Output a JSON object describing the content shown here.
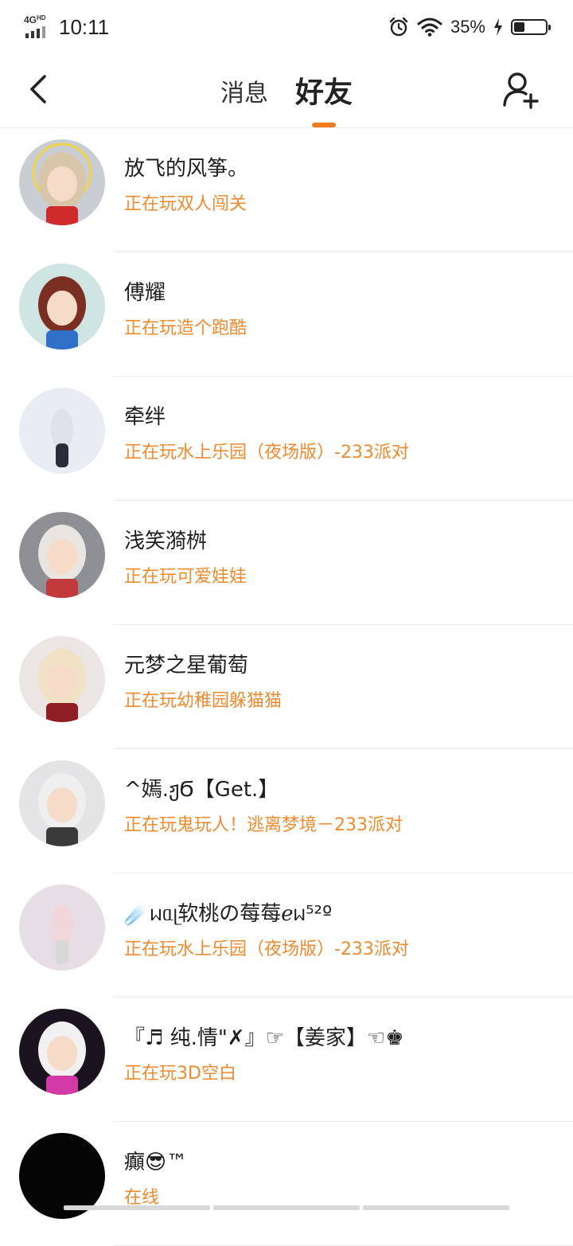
{
  "status_bar": {
    "network": "4G",
    "network_sub": "HD",
    "time": "10:11",
    "battery": "35%",
    "battery_level": 0.35
  },
  "nav": {
    "tab_messages": "消息",
    "tab_friends": "好友",
    "active_tab": "好友",
    "accent": "#f07c22"
  },
  "colors": {
    "status_text": "#f08a2e",
    "name_text": "#1e1e1e"
  },
  "friends": [
    {
      "name": "放飞的风筝。",
      "status": "正在玩双人闯关",
      "avatar_bg": "#c9cdd4",
      "hair": "#d8c6a8",
      "accent": "#d12a2a",
      "glow": "#f3d34a"
    },
    {
      "name": "傅耀",
      "status": "正在玩造个跑酷",
      "avatar_bg": "#cfe5e3",
      "hair": "#7a2f22",
      "accent": "#3070c8",
      "glow": ""
    },
    {
      "name": "牵绊",
      "status": "正在玩水上乐园（夜场版）-233派对",
      "avatar_bg": "#e8ecf4",
      "hair": "#dfe2ea",
      "accent": "#2a2e3a",
      "glow": ""
    },
    {
      "name": "浅笑漪桝",
      "status": "正在玩可爱娃娃",
      "avatar_bg": "#8e9096",
      "hair": "#e9e6e2",
      "accent": "#c23a3a",
      "glow": ""
    },
    {
      "name": "元梦之星葡萄",
      "status": "正在玩幼稚园躲猫猫",
      "avatar_bg": "#ebe5e4",
      "hair": "#f1e2c6",
      "accent": "#8f1e24",
      "glow": ""
    },
    {
      "name": "^嫣.ჟϬ【Get.】",
      "status": "正在玩鬼玩人！逃离梦境－233派对",
      "avatar_bg": "#e4e4e6",
      "hair": "#efefef",
      "accent": "#3a3a3a",
      "glow": ""
    },
    {
      "name": "☄️ᥕᥲᥨ软桃の莓莓ℯᥕ⁵²º",
      "status": "正在玩水上乐园（夜场版）-233派对",
      "avatar_bg": "#e7dde4",
      "hair": "#f1d6dc",
      "accent": "#d8d8d8",
      "glow": ""
    },
    {
      "name": "『♬ 纯.情\"✗』☞【姜家】☜♚",
      "status": "正在玩3D空白",
      "avatar_bg": "#1b1320",
      "hair": "#f1f1f1",
      "accent": "#d33aa8",
      "glow": ""
    },
    {
      "name": "癲😎™",
      "status": "在线",
      "avatar_bg": "#050505",
      "hair": "#111111",
      "accent": "#1a1a1a",
      "glow": ""
    }
  ]
}
